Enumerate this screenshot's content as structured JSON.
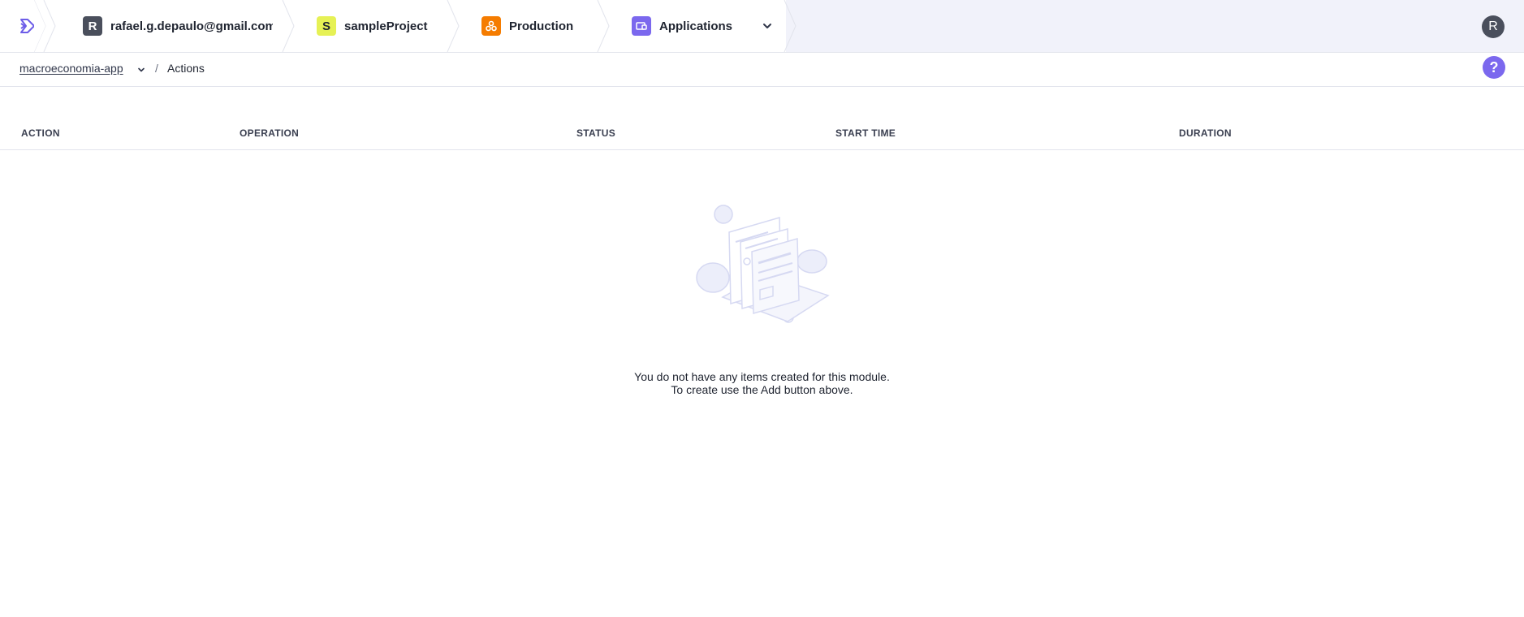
{
  "topbar": {
    "account": {
      "badge": "R",
      "label": "rafael.g.depaulo@gmail.com"
    },
    "project": {
      "badge": "S",
      "label": "sampleProject"
    },
    "environment": {
      "label": "Production"
    },
    "module": {
      "label": "Applications"
    },
    "user_avatar": "R"
  },
  "subbar": {
    "app_name": "macroeconomia-app",
    "separator": "/",
    "page_title": "Actions",
    "help_icon": "?"
  },
  "table": {
    "columns": [
      "ACTION",
      "OPERATION",
      "STATUS",
      "START TIME",
      "DURATION"
    ]
  },
  "empty_state": {
    "line1": "You do not have any items created for this module.",
    "line2": "To create use the Add button above."
  },
  "colors": {
    "accent": "#7b68ee",
    "project_badge": "#e6f155",
    "environment_badge": "#f57c00",
    "account_badge": "#4a4f5c"
  },
  "icons": [
    "harness-logo-icon",
    "chevron-down-icon",
    "environment-icon",
    "applications-icon",
    "help-icon"
  ]
}
